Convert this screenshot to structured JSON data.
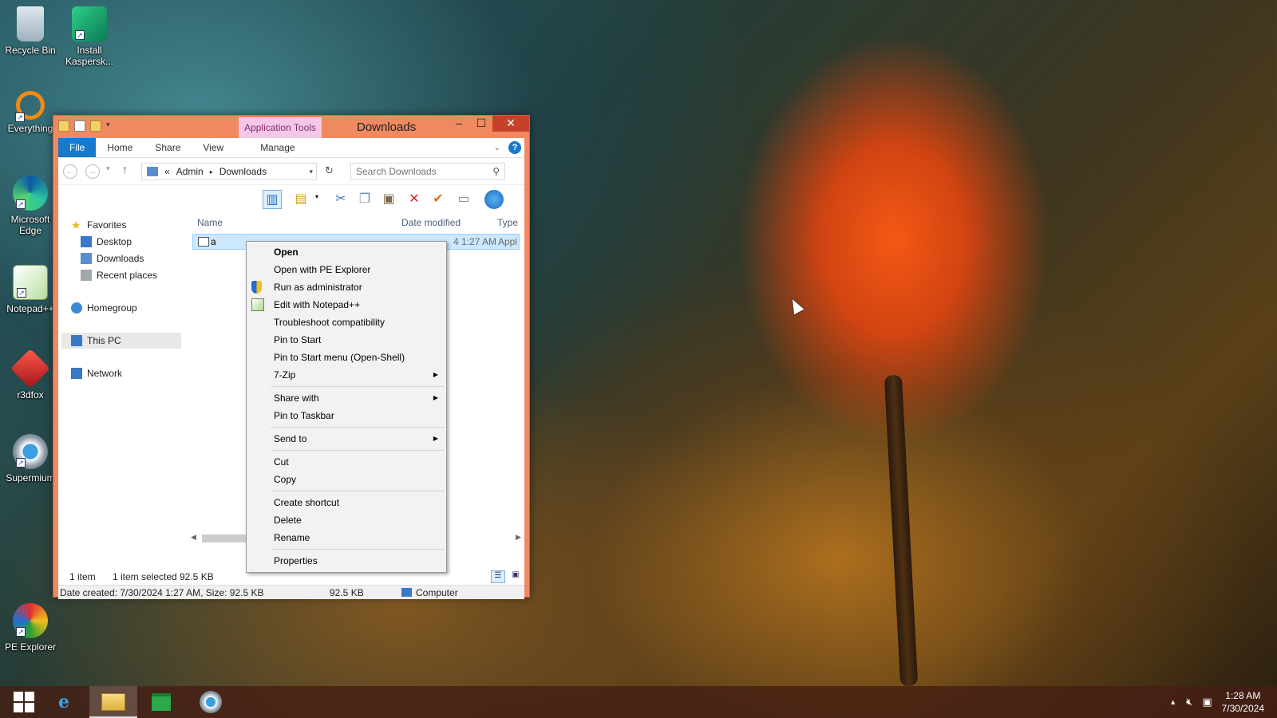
{
  "desktop": {
    "icons": [
      {
        "label": "Recycle Bin",
        "icon": "recycle-bin-icon"
      },
      {
        "label": "Install Kaspersk...",
        "icon": "kaspersky-installer-icon"
      },
      {
        "label": "Everything",
        "icon": "everything-search-icon"
      },
      {
        "label": "Microsoft Edge",
        "icon": "edge-browser-icon"
      },
      {
        "label": "Notepad++",
        "icon": "notepad-plus-plus-icon"
      },
      {
        "label": "r3dfox",
        "icon": "r3dfox-browser-icon"
      },
      {
        "label": "Supermium",
        "icon": "supermium-browser-icon"
      },
      {
        "label": "PE Explorer",
        "icon": "pe-explorer-icon"
      }
    ]
  },
  "window": {
    "title": "Downloads",
    "contextual_tab_group": "Application Tools",
    "tabs": [
      "File",
      "Home",
      "Share",
      "View",
      "Manage"
    ],
    "breadcrumb": {
      "prefix": "«",
      "items": [
        "Admin",
        "Downloads"
      ]
    },
    "search_placeholder": "Search Downloads",
    "nav_pane": {
      "favorites": "Favorites",
      "desktop": "Desktop",
      "downloads": "Downloads",
      "recent": "Recent places",
      "homegroup": "Homegroup",
      "this_pc": "This PC",
      "network": "Network"
    },
    "columns": {
      "name": "Name",
      "date_modified": "Date modified",
      "type": "Type"
    },
    "file": {
      "name": "a",
      "date_modified_partial": "4 1:27 AM",
      "type_partial": "Appl"
    },
    "status": {
      "count": "1 item",
      "selected": "1 item selected",
      "size": "92.5 KB"
    },
    "details": {
      "created": "Date created: 7/30/2024 1:27 AM, Size: 92.5 KB",
      "size": "92.5 KB",
      "location": "Computer"
    }
  },
  "context_menu": {
    "groups": [
      [
        {
          "label": "Open",
          "bold": true
        },
        {
          "label": "Open with PE Explorer"
        },
        {
          "label": "Run as administrator",
          "icon": "uac-shield-icon"
        },
        {
          "label": "Edit with Notepad++",
          "icon": "notepad-plus-plus-icon"
        },
        {
          "label": "Troubleshoot compatibility"
        },
        {
          "label": "Pin to Start"
        },
        {
          "label": "Pin to Start menu (Open-Shell)"
        },
        {
          "label": "7-Zip",
          "submenu": true
        }
      ],
      [
        {
          "label": "Share with",
          "submenu": true
        },
        {
          "label": "Pin to Taskbar"
        }
      ],
      [
        {
          "label": "Send to",
          "submenu": true
        }
      ],
      [
        {
          "label": "Cut"
        },
        {
          "label": "Copy"
        }
      ],
      [
        {
          "label": "Create shortcut"
        },
        {
          "label": "Delete"
        },
        {
          "label": "Rename"
        }
      ],
      [
        {
          "label": "Properties"
        }
      ]
    ]
  },
  "taskbar": {
    "clock_time": "1:28 AM",
    "clock_date": "7/30/2024",
    "items": [
      "start-button",
      "internet-explorer-icon",
      "file-explorer-icon",
      "store-icon",
      "supermium-browser-icon"
    ]
  },
  "colors": {
    "window_frame": "#f08860",
    "file_tab": "#1979ca",
    "selection": "#cce8ff",
    "close_button": "#c7402a",
    "contextual_tab": "#f3c8e6"
  }
}
